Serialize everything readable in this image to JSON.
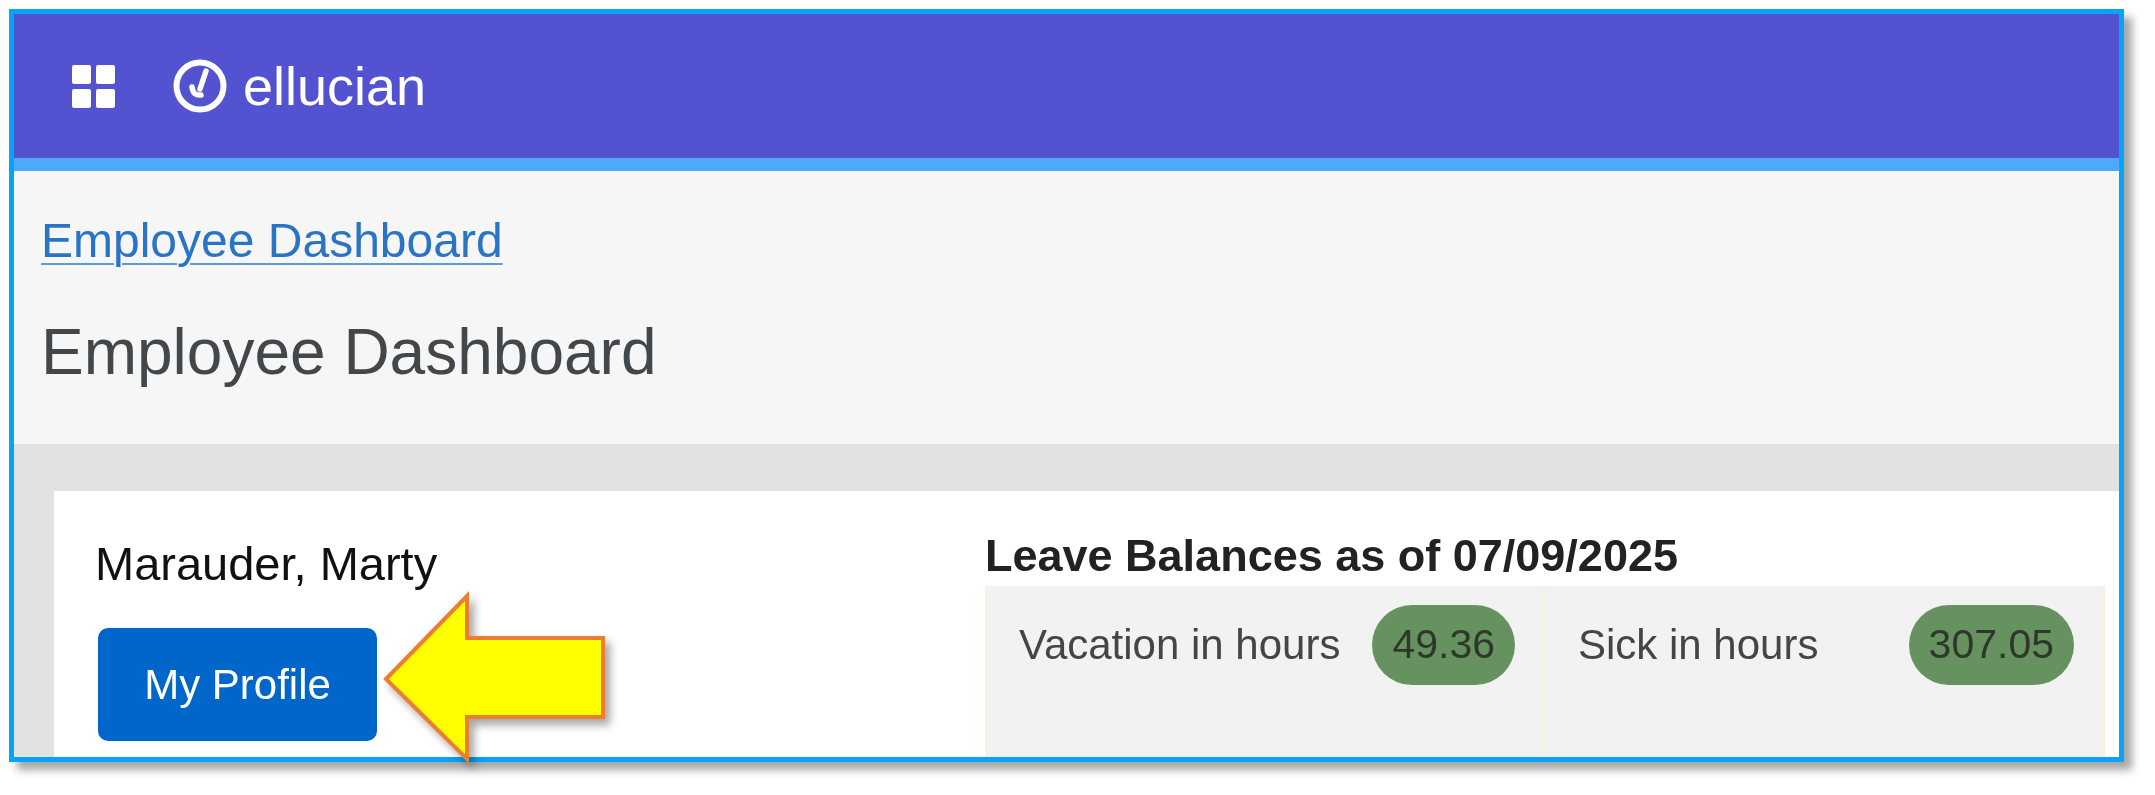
{
  "top_bar": {
    "logo_text": "ellucian"
  },
  "breadcrumb": {
    "link": "Employee Dashboard"
  },
  "page_title": "Employee Dashboard",
  "profile": {
    "name": "Marauder, Marty",
    "button": "My Profile"
  },
  "leave_balances": {
    "title": "Leave Balances as of 07/09/2025",
    "items": [
      {
        "label": "Vacation in hours",
        "value": "49.36"
      },
      {
        "label": "Sick in hours",
        "value": "307.05"
      }
    ]
  }
}
